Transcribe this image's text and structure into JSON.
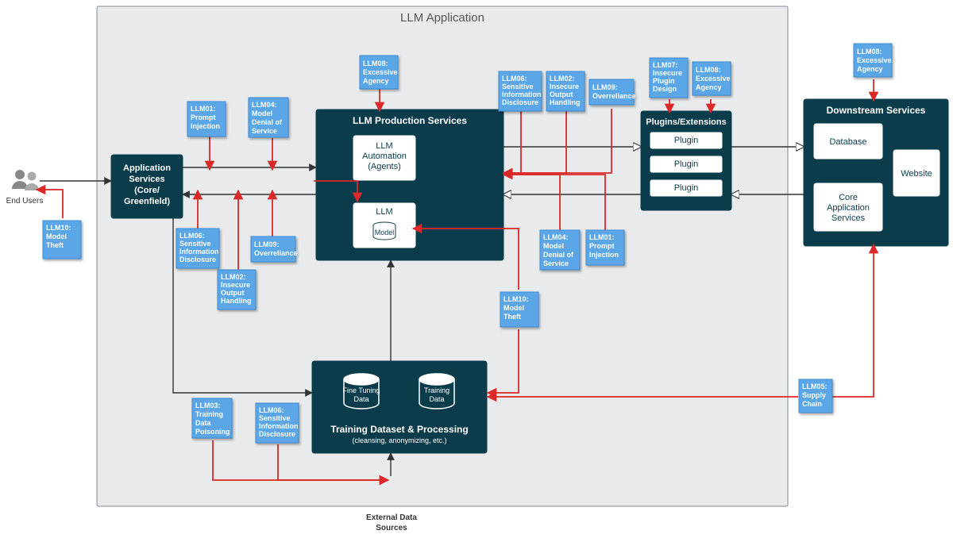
{
  "frame": {
    "title": "LLM Application"
  },
  "endusers": {
    "label": "End Users"
  },
  "external_sources": {
    "label": "External Data\nSources"
  },
  "boxes": {
    "app_services": {
      "line1": "Application",
      "line2": "Services",
      "line3": "(Core/",
      "line4": "Greenfield)"
    },
    "prod_services": {
      "title": "LLM Production Services",
      "automation": {
        "line1": "LLM",
        "line2": "Automation",
        "line3": "(Agents)"
      },
      "llm": {
        "title": "LLM",
        "model": "Model"
      }
    },
    "training": {
      "title": "Training Dataset & Processing",
      "subtitle": "(cleansing, anonymizing, etc.)",
      "finetune": "Fine Tuning\nData",
      "training_data": "Training\nData"
    },
    "plugins": {
      "title": "Plugins/Extensions",
      "items": [
        "Plugin",
        "Plugin",
        "Plugin"
      ]
    },
    "downstream": {
      "title": "Downstream Services",
      "db": "Database",
      "core": "Core\nApplication\nServices",
      "website": "Website"
    }
  },
  "stickies": {
    "llm01a": "LLM01:\nPrompt\nInjection",
    "llm01b": "LLM01:\nPrompt\nInjection",
    "llm02a": "LLM02:\nInsecure\nOutput\nHandling",
    "llm02b": "LLM02:\nInsecure\nOutput\nHandling",
    "llm03": "LLM03:\nTraining\nData\nPoisoning",
    "llm04a": "LLM04:\nModel\nDenial of\nService",
    "llm04b": "LLM04:\nModel\nDenial of\nService",
    "llm05": "LLM05:\nSupply\nChain",
    "llm06a": "LLM06:\nSensitive\nInformation\nDisclosure",
    "llm06b": "LLM06:\nSensitive\nInformation\nDisclosure",
    "llm06c": "LLM06:\nSensitive\nInformation\nDisclosure",
    "llm07": "LLM07:\nInsecure\nPlugin\nDesign",
    "llm08a": "LLM08:\nExcessive\nAgency",
    "llm08b": "LLM08:\nExcessive\nAgency",
    "llm08c": "LLM08:\nExcessive\nAgency",
    "llm09a": "LLM09:\nOverreliance",
    "llm09b": "LLM09:\nOverreliance",
    "llm10a": "LLM10:\nModel\nTheft",
    "llm10b": "LLM10:\nModel\nTheft"
  }
}
